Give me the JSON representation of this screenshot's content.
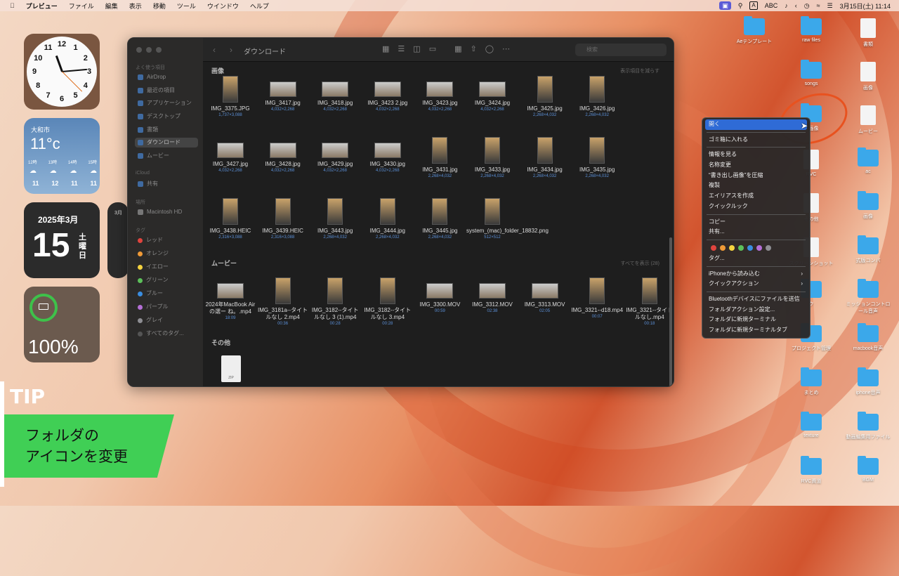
{
  "menubar": {
    "apple": "",
    "app": "プレビュー",
    "menus": [
      "ファイル",
      "編集",
      "表示",
      "移動",
      "ツール",
      "ウインドウ",
      "ヘルプ"
    ],
    "input_a": "A",
    "input_abc": "ABC",
    "datetime": "3月15日(土) 11:14"
  },
  "widgets": {
    "clock_numbers": [
      "12",
      "1",
      "2",
      "3",
      "4",
      "5",
      "6",
      "7",
      "8",
      "9",
      "10",
      "11"
    ],
    "weather": {
      "city": "大和市",
      "temp": "11°c",
      "hours": [
        "12時",
        "13時",
        "14時",
        "15時"
      ],
      "temps": [
        "11",
        "12",
        "11",
        "11"
      ]
    },
    "calendar": {
      "month": "2025年3月",
      "day": "15",
      "weekday": "土\n曜\n日"
    },
    "calendar2": {
      "month": "3月"
    },
    "battery": {
      "percent": "100%"
    }
  },
  "tip": {
    "label": "TIP",
    "text": "フォルダの\nアイコンを変更"
  },
  "finder": {
    "title": "ダウンロード",
    "search_placeholder": "検索",
    "sidebar": {
      "favorites_label": "よく使う項目",
      "favorites": [
        "AirDrop",
        "最近の項目",
        "アプリケーション",
        "デスクトップ",
        "書類",
        "ダウンロード",
        "ムービー"
      ],
      "icloud_label": "iCloud",
      "icloud": [
        "共有"
      ],
      "places_label": "場所",
      "places": [
        "Macintosh HD"
      ],
      "tags_label": "タグ",
      "tags": [
        {
          "name": "レッド",
          "color": "#e0443e"
        },
        {
          "name": "オレンジ",
          "color": "#f09a37"
        },
        {
          "name": "イエロー",
          "color": "#f5d33f"
        },
        {
          "name": "グリーン",
          "color": "#5cc05a"
        },
        {
          "name": "ブルー",
          "color": "#3a8de0"
        },
        {
          "name": "パープル",
          "color": "#b46fd6"
        },
        {
          "name": "グレイ",
          "color": "#8e8e93"
        },
        {
          "name": "すべてのタグ...",
          "color": "#555555"
        }
      ]
    },
    "images_section": "画像",
    "images_link": "表示項目を減らす",
    "images": [
      {
        "name": "IMG_3375.JPG",
        "meta": "1,737×3,088"
      },
      {
        "name": "IMG_3417.jpg",
        "meta": "4,032×2,268"
      },
      {
        "name": "IMG_3418.jpg",
        "meta": "4,032×2,268"
      },
      {
        "name": "IMG_3423 2.jpg",
        "meta": "4,032×2,268"
      },
      {
        "name": "IMG_3423.jpg",
        "meta": "4,032×2,268"
      },
      {
        "name": "IMG_3424.jpg",
        "meta": "4,032×2,268"
      },
      {
        "name": "IMG_3425.jpg",
        "meta": "2,268×4,032"
      },
      {
        "name": "IMG_3426.jpg",
        "meta": "2,268×4,032"
      },
      {
        "name": "IMG_3427.jpg",
        "meta": "4,032×2,268"
      },
      {
        "name": "IMG_3428.jpg",
        "meta": "4,032×2,268"
      },
      {
        "name": "IMG_3429.jpg",
        "meta": "4,032×2,268"
      },
      {
        "name": "IMG_3430.jpg",
        "meta": "4,032×2,268"
      },
      {
        "name": "IMG_3431.jpg",
        "meta": "2,268×4,032"
      },
      {
        "name": "IMG_3433.jpg",
        "meta": "2,268×4,032"
      },
      {
        "name": "IMG_3434.jpg",
        "meta": "2,268×4,032"
      },
      {
        "name": "IMG_3435.jpg",
        "meta": "2,268×4,032"
      },
      {
        "name": "IMG_3438.HEIC",
        "meta": "2,316×3,088"
      },
      {
        "name": "IMG_3439.HEIC",
        "meta": "2,316×3,088"
      },
      {
        "name": "IMG_3443.jpg",
        "meta": "2,268×4,032"
      },
      {
        "name": "IMG_3444.jpg",
        "meta": "2,268×4,032"
      },
      {
        "name": "IMG_3445.jpg",
        "meta": "2,268×4,032"
      },
      {
        "name": "system_(mac)_folder_18832.png",
        "meta": "512×512"
      }
    ],
    "movies_section": "ムービー",
    "movies_link": "すべてを表示 (28)",
    "movies": [
      {
        "name": "2024年MacBook Airの選ー ね。.mp4",
        "meta": "18:09"
      },
      {
        "name": "IMG_3181a--タイトルなし 2.mp4",
        "meta": "00:36"
      },
      {
        "name": "IMG_3182--タイトルなし 3 (1).mp4",
        "meta": "00:28"
      },
      {
        "name": "IMG_3182--タイトルなし 3.mp4",
        "meta": "00:28"
      },
      {
        "name": "IMG_3300.MOV",
        "meta": "00:59"
      },
      {
        "name": "IMG_3312.MOV",
        "meta": "02:38"
      },
      {
        "name": "IMG_3313.MOV",
        "meta": "02:05"
      },
      {
        "name": "IMG_3321--d18.mp4",
        "meta": "00:07"
      },
      {
        "name": "IMG_3321--タイトルなし.mp4",
        "meta": "00:18"
      }
    ],
    "other_section": "その他",
    "zip_label": "ZIP"
  },
  "desktop": {
    "icons": [
      {
        "name": "Aeテンプレート",
        "type": "folder"
      },
      {
        "name": "raw files",
        "type": "folder"
      },
      {
        "name": "書類",
        "type": "doc"
      },
      {
        "name": "songs",
        "type": "folder"
      },
      {
        "name": "画像",
        "type": "doc"
      },
      {
        "name": "し画像",
        "type": "folder"
      },
      {
        "name": "ムービー",
        "type": "doc"
      },
      {
        "name": "RVC",
        "type": "doc"
      },
      {
        "name": "ac",
        "type": "folder"
      },
      {
        "name": "その他",
        "type": "doc"
      },
      {
        "name": "画像",
        "type": "folder"
      },
      {
        "name": "スクリーンショット",
        "type": "doc"
      },
      {
        "name": "式版コンパ",
        "type": "folder"
      },
      {
        "name": "ク",
        "type": "folder"
      },
      {
        "name": "ミッションコントロール音声",
        "type": "folder"
      },
      {
        "name": "プロジェクト管理",
        "type": "folder"
      },
      {
        "name": "macbook音声",
        "type": "folder"
      },
      {
        "name": "まとめ",
        "type": "folder"
      },
      {
        "name": "iphone音声",
        "type": "folder"
      },
      {
        "name": "texture",
        "type": "folder"
      },
      {
        "name": "動画編集用ファイル",
        "type": "folder"
      },
      {
        "name": "RVC資道",
        "type": "folder"
      },
      {
        "name": "BGM",
        "type": "folder"
      }
    ]
  },
  "context_menu": {
    "items_a": [
      "開く",
      "ゴミ箱に入れる"
    ],
    "items_b": [
      "情報を見る",
      "名称変更",
      "“書き出し画像”を圧縮",
      "複製",
      "エイリアスを作成",
      "クイックルック"
    ],
    "items_c": [
      "コピー",
      "共有..."
    ],
    "tag_colors": [
      "#e0443e",
      "#f09a37",
      "#f5d33f",
      "#5cc05a",
      "#3a8de0",
      "#b46fd6",
      "#8e8e93"
    ],
    "tags_item": "タグ...",
    "items_d": [
      "iPhoneから読み込む",
      "クイックアクション"
    ],
    "items_e": [
      "Bluetoothデバイスにファイルを送信",
      "フォルダアクション設定...",
      "フォルダに新規ターミナル",
      "フォルダに新規ターミナルタブ"
    ]
  }
}
